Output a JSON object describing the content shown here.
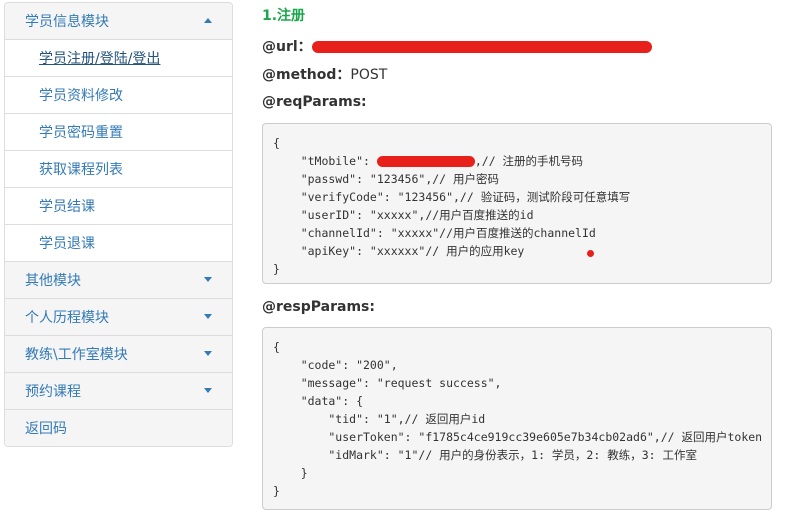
{
  "sidebar": {
    "groups": [
      {
        "label": "学员信息模块",
        "expanded": true,
        "items": [
          "学员注册/登陆/登出",
          "学员资料修改",
          "学员密码重置",
          "获取课程列表",
          "学员结课",
          "学员退课"
        ]
      },
      {
        "label": "其他模块"
      },
      {
        "label": "个人历程模块"
      },
      {
        "label": "教练\\工作室模块"
      },
      {
        "label": "预约课程"
      },
      {
        "label": "返回码"
      }
    ]
  },
  "doc": {
    "section_title": "1.注册",
    "url_label": "@url：",
    "method_label": "@method：",
    "method_value": "POST",
    "req_label": "@reqParams:",
    "resp_label": "@respParams:",
    "req_lines": [
      "{",
      "    \"tMobile\": ",
      "    \"passwd\": \"123456\",// 用户密码",
      "    \"verifyCode\": \"123456\",// 验证码，测试阶段可任意填写",
      "    \"userID\": \"xxxxx\",//用户百度推送的id",
      "    \"channelId\": \"xxxxx\"//用户百度推送的channelId",
      "    \"apiKey\": \"xxxxxx\"// 用户的应用key",
      "}"
    ],
    "req_mobile_comment": ",// 注册的手机号码",
    "resp_lines": [
      "{",
      "    \"code\": \"200\",",
      "    \"message\": \"request success\",",
      "    \"data\": {",
      "        \"tid\": \"1\",// 返回用户id",
      "        \"userToken\": \"f1785c4ce919cc39e605e7b34cb02ad6\",// 返回用户token",
      "        \"idMark\": \"1\"// 用户的身份表示，1: 学员，2: 教练，3: 工作室",
      "    }",
      "}"
    ]
  },
  "colors": {
    "link": "#337ab7",
    "title_green": "#1aa64a",
    "redaction": "#e8201c"
  }
}
